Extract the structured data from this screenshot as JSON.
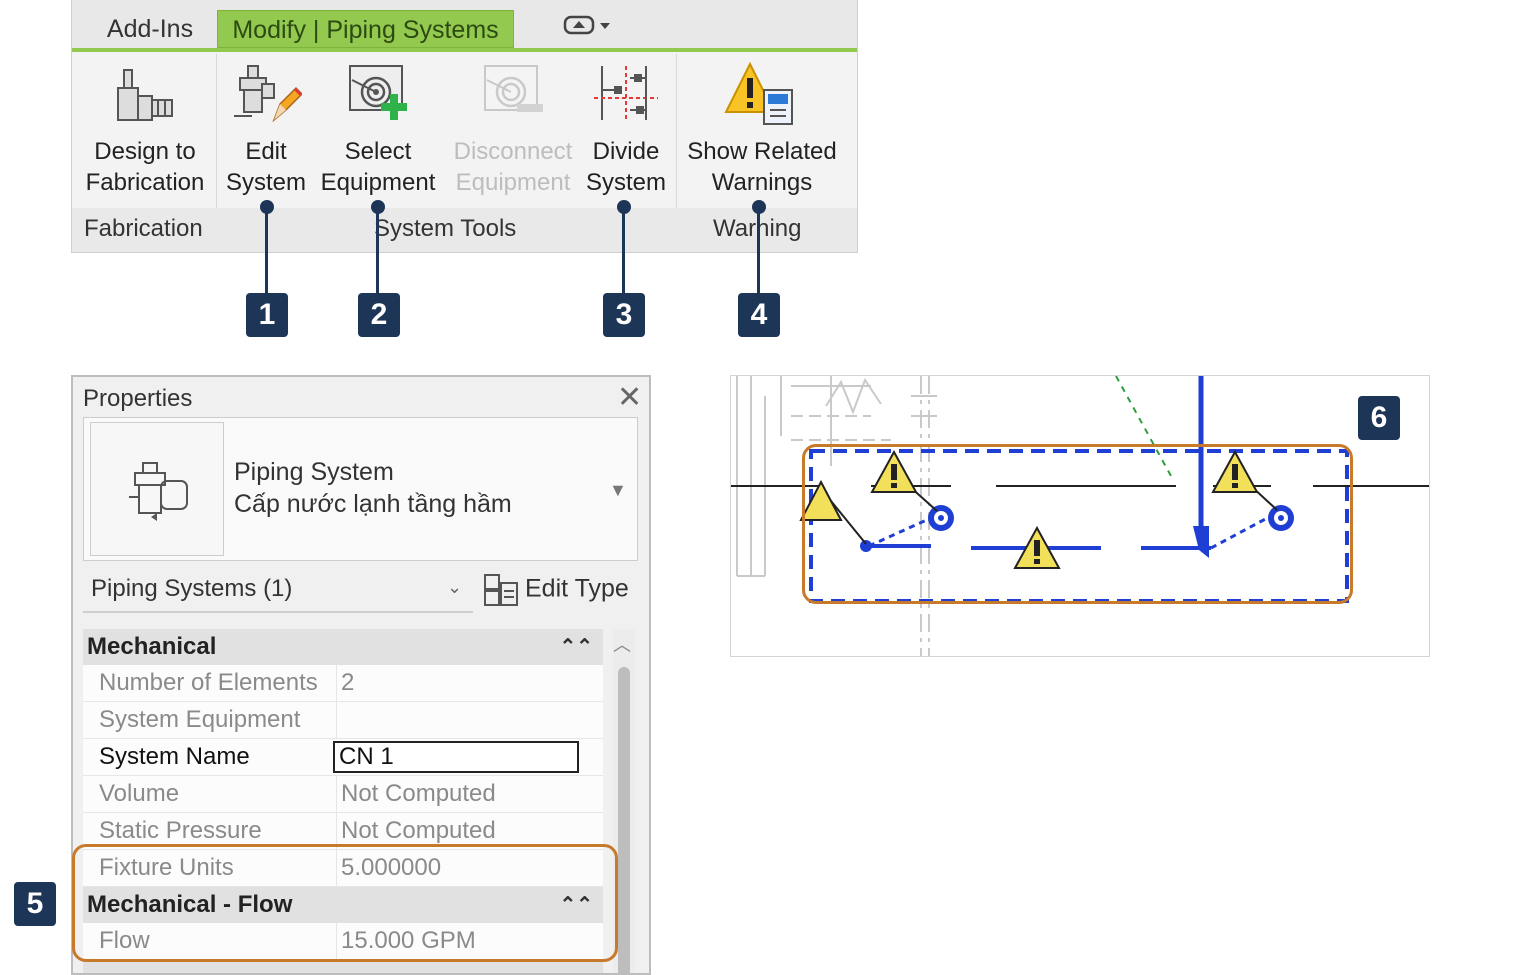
{
  "ribbon": {
    "tabs": [
      "Add-Ins",
      "Modify | Piping Systems"
    ],
    "tools": {
      "design_fab": [
        "Design to",
        "Fabrication"
      ],
      "edit_system": [
        "Edit",
        "System"
      ],
      "select_equipment": [
        "Select",
        "Equipment"
      ],
      "disconnect_equipment": [
        "Disconnect",
        "Equipment"
      ],
      "divide_system": [
        "Divide",
        "System"
      ],
      "show_warnings": [
        "Show Related",
        "Warnings"
      ]
    },
    "panels": [
      "Fabrication",
      "System Tools",
      "Warning"
    ]
  },
  "callouts": [
    "1",
    "2",
    "3",
    "4",
    "5",
    "6"
  ],
  "properties": {
    "title": "Properties",
    "type_name": "Piping System",
    "type_sub": "Cấp nước lạnh tầng hầm",
    "filter": "Piping Systems (1)",
    "edit_type": "Edit Type",
    "groups": [
      "Mechanical",
      "Mechanical - Flow"
    ],
    "rows": [
      {
        "k": "Number of Elements",
        "v": "2"
      },
      {
        "k": "System Equipment",
        "v": ""
      },
      {
        "k": "System Name",
        "v": "CN 1"
      },
      {
        "k": "Volume",
        "v": "Not Computed"
      },
      {
        "k": "Static Pressure",
        "v": "Not Computed"
      },
      {
        "k": "Fixture Units",
        "v": "5.000000"
      },
      {
        "k": "Flow",
        "v": "15.000 GPM"
      }
    ]
  },
  "colors": {
    "accent_tab": "#93c94e",
    "callout": "#1d3557",
    "highlight": "#c87a2b",
    "pipe": "#1f3fd4"
  }
}
